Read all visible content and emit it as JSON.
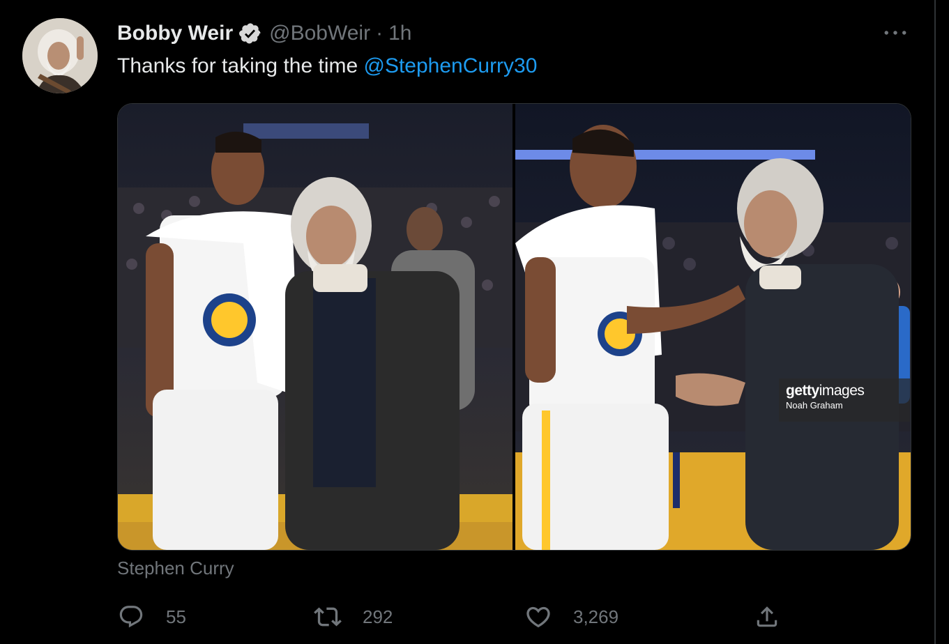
{
  "tweet": {
    "author": {
      "display_name": "Bobby Weir",
      "handle": "@BobWeir",
      "verified": true
    },
    "separator": "·",
    "time": "1h",
    "text": "Thanks for taking the time ",
    "mention": "@StephenCurry30",
    "media": {
      "photo_count": 2,
      "getty": {
        "brand_bold": "getty",
        "brand_light": "images",
        "credit": "Noah Graham"
      }
    },
    "tagged": "Stephen Curry",
    "actions": {
      "replies": "55",
      "retweets": "292",
      "likes": "3,269"
    }
  },
  "icons": {
    "verified": "verified-badge-icon",
    "more": "more-dots-icon",
    "reply": "reply-bubble-icon",
    "retweet": "retweet-icon",
    "like": "heart-icon",
    "share": "share-upload-icon"
  },
  "colors": {
    "background": "#000000",
    "text": "#e7e9ea",
    "muted": "#71767b",
    "link": "#1d9bf0",
    "border": "#2f3336"
  }
}
